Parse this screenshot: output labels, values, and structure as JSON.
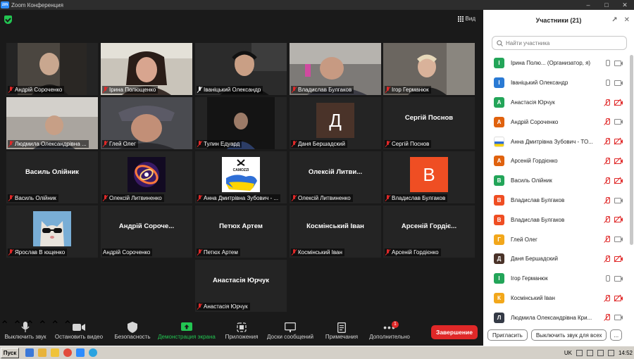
{
  "window": {
    "title": "Zoom Конференция",
    "logo": "zm"
  },
  "view_button": {
    "label": "Вид"
  },
  "tiles": [
    {
      "name": "Андрій Сороченко",
      "type": "video"
    },
    {
      "name": "Ірина Полющенко",
      "type": "video",
      "active": true
    },
    {
      "name": "Іваніцький Олександр",
      "type": "video",
      "mic_on": true
    },
    {
      "name": "Владислав Булгаков",
      "type": "video"
    },
    {
      "name": "Ігор Германюк",
      "type": "video",
      "mic_on": true
    },
    {
      "name": "Людмила Олександрівна ...",
      "type": "video"
    },
    {
      "name": "Глей Олег",
      "type": "video"
    },
    {
      "name": "Тулин Едуард",
      "type": "video"
    },
    {
      "name": "Даня Бершадский",
      "type": "avatar",
      "letter": "Д",
      "color": "#4a3329"
    },
    {
      "name": "Сергій Поснов",
      "type": "name",
      "display": "Сергій Поснов"
    },
    {
      "name": "Василь Олійник",
      "type": "name",
      "display": "Василь Олійник"
    },
    {
      "name": "Олексій Литвиненко",
      "type": "image"
    },
    {
      "name": "Анна Дмитрівна Зубович - ...",
      "type": "image"
    },
    {
      "name": "Олексій Литвиненко",
      "type": "name",
      "display": "Олексій  Литви..."
    },
    {
      "name": "Владислав Булгаков",
      "type": "avatar",
      "letter": "В",
      "color": "#ef4e23"
    },
    {
      "name": "Ярослав В ющенко",
      "type": "image"
    },
    {
      "name": "Андрій Сороченко",
      "type": "name",
      "display": "Андрій  Сороче..."
    },
    {
      "name": "Петюх Артем",
      "type": "name",
      "display": "Петюх Артем"
    },
    {
      "name": "Космінський Іван",
      "type": "name",
      "display": "Космінський Іван"
    },
    {
      "name": "Арсеній Гордієнко",
      "type": "name",
      "display": "Арсеній  Гордіє..."
    },
    {
      "name": "Анастасія Юрчук",
      "type": "name",
      "display": "Анастасія  Юрчук"
    }
  ],
  "camozzi": {
    "text": "CAMOZZI"
  },
  "toolbar": {
    "mute": "Выключить звук",
    "video": "Остановить видео",
    "security": "Безопасность",
    "share": "Демонстрация экрана",
    "apps": "Приложения",
    "whiteboards": "Доски сообщений",
    "notes": "Примечания",
    "more": "Дополнительно",
    "more_badge": "1",
    "end": "Завершение"
  },
  "participants": {
    "title": "Участники (21)",
    "search_placeholder": "Найти участника",
    "invite": "Пригласить",
    "mute_all": "Выключить звук для всех",
    "more": "...",
    "list": [
      {
        "letter": "І",
        "color": "#23a559",
        "name": "Ірина Полю...  (Организатор, я)",
        "mic": "on",
        "cam": "on"
      },
      {
        "letter": "І",
        "color": "#2a7ad4",
        "name": "Іваніцький Олександр",
        "mic": "on",
        "cam": "on"
      },
      {
        "letter": "А",
        "color": "#23a559",
        "name": "Анастасія Юрчук",
        "mic": "off",
        "cam": "off"
      },
      {
        "letter": "А",
        "color": "#e0620e",
        "name": "Андрій Сороченко",
        "mic": "off",
        "cam": "on"
      },
      {
        "letter": "",
        "color": "#ffffff",
        "name": "Анна Дмитрівна Зубович - ТО...",
        "mic": "off",
        "cam": "off",
        "img": true
      },
      {
        "letter": "А",
        "color": "#e0620e",
        "name": "Арсеній Гордієнко",
        "mic": "off",
        "cam": "off"
      },
      {
        "letter": "В",
        "color": "#23a559",
        "name": "Василь Олійник",
        "mic": "off",
        "cam": "off"
      },
      {
        "letter": "В",
        "color": "#ef4e23",
        "name": "Владислав Булгаков",
        "mic": "off",
        "cam": "on"
      },
      {
        "letter": "В",
        "color": "#ef4e23",
        "name": "Владислав Булгаков",
        "mic": "off",
        "cam": "off"
      },
      {
        "letter": "Г",
        "color": "#f2a71b",
        "name": "Глей Олег",
        "mic": "off",
        "cam": "on"
      },
      {
        "letter": "Д",
        "color": "#4a3329",
        "name": "Даня Бершадский",
        "mic": "off",
        "cam": "off"
      },
      {
        "letter": "І",
        "color": "#23a559",
        "name": "Ігор Германюк",
        "mic": "on",
        "cam": "on"
      },
      {
        "letter": "К",
        "color": "#f2a71b",
        "name": "Космінський Іван",
        "mic": "off",
        "cam": "off"
      },
      {
        "letter": "Л",
        "color": "#343a46",
        "name": "Людмила Олександрівна Кри...",
        "mic": "off",
        "cam": "on"
      }
    ]
  },
  "taskbar": {
    "start": "Пуск",
    "lang": "UK",
    "time": "14:52"
  }
}
